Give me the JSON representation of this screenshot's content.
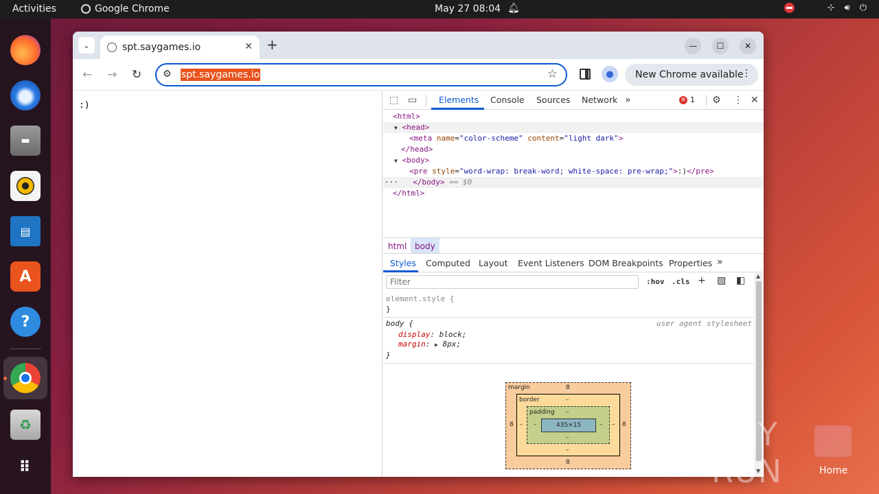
{
  "topbar": {
    "activities": "Activities",
    "app_name": "Google Chrome",
    "clock": "May 27  08:04"
  },
  "dock": {
    "items": [
      "firefox-icon",
      "thunderbird-icon",
      "files-icon",
      "rhythmbox-icon",
      "writer-icon",
      "app-center-icon",
      "help-icon",
      "chrome-icon",
      "trash-icon",
      "show-apps-icon"
    ]
  },
  "browser": {
    "tab_title": "spt.saygames.io",
    "url": "spt.saygames.io",
    "update_button": "New Chrome available"
  },
  "page": {
    "content": ":)"
  },
  "devtools": {
    "tabs": [
      "Elements",
      "Console",
      "Sources",
      "Network"
    ],
    "error_count": "1",
    "dom": {
      "html_open": "<html>",
      "head_open": "<head>",
      "meta_tag": "<meta",
      "meta_attr1_name": "name",
      "meta_attr1_value": "\"color-scheme\"",
      "meta_attr2_name": "content",
      "meta_attr2_value": "\"light dark\"",
      "meta_close": ">",
      "head_close": "</head>",
      "body_open": "<body>",
      "pre_open": "<pre",
      "pre_attr_name": "style",
      "pre_attr_value": "\"word-wrap: break-word; white-space: pre-wrap;\"",
      "pre_text": ":)",
      "pre_close": "</pre>",
      "body_close": "</body>",
      "selected_marker": "== $0",
      "html_close": "</html>"
    },
    "breadcrumbs": [
      "html",
      "body"
    ],
    "styles_tabs": [
      "Styles",
      "Computed",
      "Layout",
      "Event Listeners",
      "DOM Breakpoints",
      "Properties"
    ],
    "filter_placeholder": "Filter",
    "hov": ":hov",
    "cls": ".cls",
    "rules": {
      "element_style": "element.style {",
      "close_brace": "}",
      "body_selector": "body {",
      "source": "user agent stylesheet",
      "prop1": "display",
      "val1": "block;",
      "prop2": "margin",
      "val2": "8px;"
    },
    "box_model": {
      "margin_label": "margin",
      "border_label": "border",
      "padding_label": "padding",
      "margin_top": "8",
      "margin_bottom": "8",
      "margin_left": "8",
      "margin_right": "8",
      "border_top": "–",
      "border_bottom": "–",
      "border_left": "–",
      "border_right": "–",
      "padding_top": "–",
      "padding_bottom": "–",
      "padding_left": "–",
      "padding_right": "–",
      "content": "435×15"
    }
  },
  "desktop": {
    "watermark": "ANY RUN",
    "home_label": "Home"
  }
}
